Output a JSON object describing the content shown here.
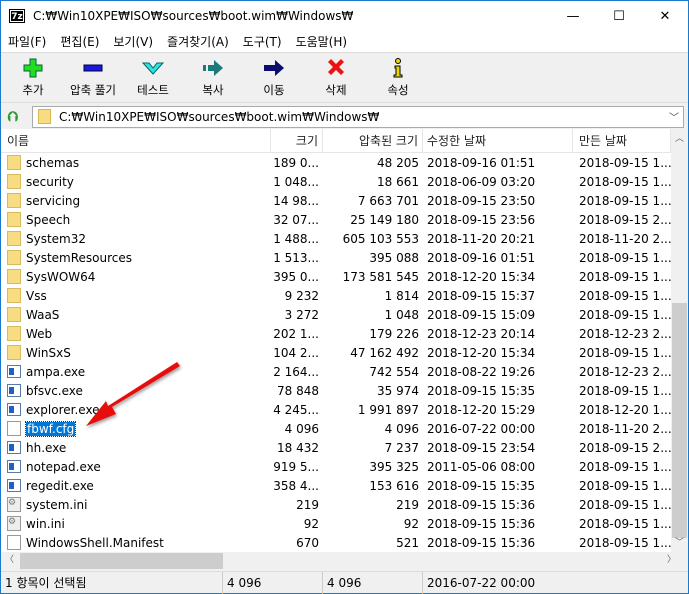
{
  "window": {
    "title": "C:₩Win10XPE₩ISO₩sources₩boot.wim₩Windows₩",
    "app_icon": "7z",
    "controls": [
      "—",
      "☐",
      "✕"
    ]
  },
  "menu": [
    "파일(F)",
    "편집(E)",
    "보기(V)",
    "즐겨찾기(A)",
    "도구(T)",
    "도움말(H)"
  ],
  "toolbar": [
    {
      "label": "추가",
      "icon": "plus-icon",
      "color": "#22dd22"
    },
    {
      "label": "압축 풀기",
      "icon": "minus-icon",
      "color": "#1a1adb"
    },
    {
      "label": "테스트",
      "icon": "check-icon",
      "color": "#33e0e0"
    },
    {
      "label": "복사",
      "icon": "copy-arrow-icon",
      "color": "#1a7a7a"
    },
    {
      "label": "이동",
      "icon": "move-arrow-icon",
      "color": "#0b0b70"
    },
    {
      "label": "삭제",
      "icon": "delete-x-icon",
      "color": "#ee1111"
    },
    {
      "label": "속성",
      "icon": "info-icon",
      "color": "#e8d800"
    }
  ],
  "address": {
    "path": "C:₩Win10XPE₩ISO₩sources₩boot.wim₩Windows₩"
  },
  "columns": [
    "이름",
    "크기",
    "압축된 크기",
    "수정한 날짜",
    "만든 날짜"
  ],
  "rows": [
    {
      "type": "folder",
      "name": "schemas",
      "size": "189 0...",
      "packed": "48 205",
      "modified": "2018-09-16 01:51",
      "created": "2018-09-15 1..."
    },
    {
      "type": "folder",
      "name": "security",
      "size": "1 048...",
      "packed": "18 661",
      "modified": "2018-06-09 03:20",
      "created": "2018-09-15 1..."
    },
    {
      "type": "folder",
      "name": "servicing",
      "size": "14 98...",
      "packed": "7 663 701",
      "modified": "2018-09-15 23:50",
      "created": "2018-09-15 1..."
    },
    {
      "type": "folder",
      "name": "Speech",
      "size": "32 07...",
      "packed": "25 149 180",
      "modified": "2018-09-15 23:56",
      "created": "2018-09-15 2..."
    },
    {
      "type": "folder",
      "name": "System32",
      "size": "1 488...",
      "packed": "605 103 553",
      "modified": "2018-11-20 20:21",
      "created": "2018-11-20 2..."
    },
    {
      "type": "folder",
      "name": "SystemResources",
      "size": "1 513...",
      "packed": "395 088",
      "modified": "2018-09-16 01:51",
      "created": "2018-09-15 1..."
    },
    {
      "type": "folder",
      "name": "SysWOW64",
      "size": "395 0...",
      "packed": "173 581 545",
      "modified": "2018-12-20 15:34",
      "created": "2018-09-15 1..."
    },
    {
      "type": "folder",
      "name": "Vss",
      "size": "9 232",
      "packed": "1 814",
      "modified": "2018-09-15 15:37",
      "created": "2018-09-15 1..."
    },
    {
      "type": "folder",
      "name": "WaaS",
      "size": "3 272",
      "packed": "1 048",
      "modified": "2018-09-15 15:09",
      "created": "2018-09-15 1..."
    },
    {
      "type": "folder",
      "name": "Web",
      "size": "202 1...",
      "packed": "179 226",
      "modified": "2018-12-23 20:14",
      "created": "2018-12-23 2..."
    },
    {
      "type": "folder",
      "name": "WinSxS",
      "size": "104 2...",
      "packed": "47 162 492",
      "modified": "2018-12-20 15:34",
      "created": "2018-09-15 1..."
    },
    {
      "type": "exe",
      "name": "ampa.exe",
      "size": "2 164...",
      "packed": "742 554",
      "modified": "2018-08-22 19:26",
      "created": "2018-12-23 2..."
    },
    {
      "type": "exe",
      "name": "bfsvc.exe",
      "size": "78 848",
      "packed": "35 974",
      "modified": "2018-09-15 15:35",
      "created": "2018-09-15 1..."
    },
    {
      "type": "exe",
      "name": "explorer.exe",
      "size": "4 245...",
      "packed": "1 991 897",
      "modified": "2018-12-20 15:29",
      "created": "2018-12-20 1..."
    },
    {
      "type": "file",
      "name": "fbwf.cfg",
      "size": "4 096",
      "packed": "4 096",
      "modified": "2016-07-22 00:00",
      "created": "2018-11-20 2...",
      "selected": true
    },
    {
      "type": "exe",
      "name": "hh.exe",
      "size": "18 432",
      "packed": "7 237",
      "modified": "2018-09-15 23:54",
      "created": "2018-09-15 2..."
    },
    {
      "type": "exe",
      "name": "notepad.exe",
      "size": "919 5...",
      "packed": "395 325",
      "modified": "2011-05-06 08:00",
      "created": "2018-09-15 1..."
    },
    {
      "type": "exe",
      "name": "regedit.exe",
      "size": "358 4...",
      "packed": "153 616",
      "modified": "2018-09-15 15:35",
      "created": "2018-09-15 1..."
    },
    {
      "type": "ini",
      "name": "system.ini",
      "size": "219",
      "packed": "219",
      "modified": "2018-09-15 15:36",
      "created": "2018-09-15 1..."
    },
    {
      "type": "ini",
      "name": "win.ini",
      "size": "92",
      "packed": "92",
      "modified": "2018-09-15 15:36",
      "created": "2018-09-15 1..."
    },
    {
      "type": "file",
      "name": "WindowsShell.Manifest",
      "size": "670",
      "packed": "521",
      "modified": "2018-09-15 15:36",
      "created": "2018-09-15 1..."
    }
  ],
  "status": {
    "selection": "1 항목이 선택됨",
    "size": "4 096",
    "packed": "4 096",
    "date": "2016-07-22 00:00"
  },
  "annotation": {
    "color": "#e81010"
  }
}
